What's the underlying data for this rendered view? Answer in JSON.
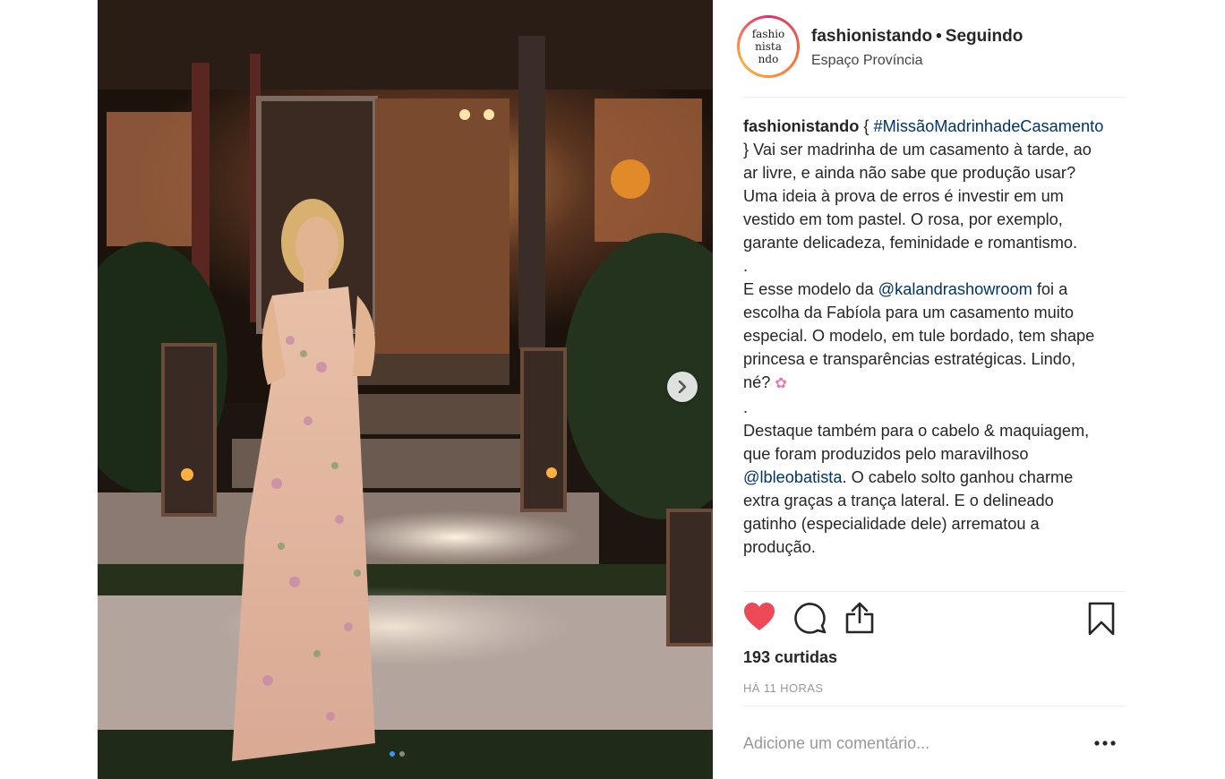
{
  "post": {
    "username": "fashionistando",
    "separator": "•",
    "follow_status": "Seguindo",
    "location": "Espaço Província",
    "avatar_text_lines": [
      "fashio",
      "nista",
      "ndo"
    ]
  },
  "caption": {
    "author": "fashionistando",
    "p1_open": " { ",
    "hashtag": "#MissãoMadrinhadeCasamento",
    "p1_rest": " } Vai ser madrinha de um casamento à tarde, ao ar livre, e ainda não sabe que produção usar? Uma ideia à prova de erros é investir em um vestido em tom pastel. O rosa, por exemplo, garante delicadeza, feminidade e romantismo.",
    "dot1": ".",
    "p2_pre": "E esse modelo da ",
    "mention1": "@kalandrashowroom",
    "p2_rest": " foi a escolha da Fabíola para um casamento muito especial. O modelo, em tule bordado, tem shape princesa e transparências estratégicas. Lindo, né? ",
    "emoji": "✿",
    "dot2": ".",
    "p3_pre": "Destaque também para o cabelo & maquiagem, que foram produzidos pelo maravilhoso ",
    "mention2": "@lbleobatista",
    "p3_rest": ". O cabelo solto ganhou charme extra graças a trança lateral. E o delineado gatinho (especialidade dele) arrematou a produção."
  },
  "stats": {
    "likes": "193 curtidas",
    "time": "HÁ 11 HORAS"
  },
  "comment": {
    "placeholder": "Adicione um comentário..."
  },
  "icons": {
    "like": "heart-icon",
    "comment": "comment-icon",
    "share": "share-icon",
    "save": "bookmark-icon",
    "more": "more-icon",
    "next": "chevron-right-icon"
  },
  "colors": {
    "like_active": "#ed4956",
    "link": "#003569",
    "carousel_dot_active": "#3897f0"
  },
  "carousel": {
    "count": 2,
    "active_index": 0
  }
}
